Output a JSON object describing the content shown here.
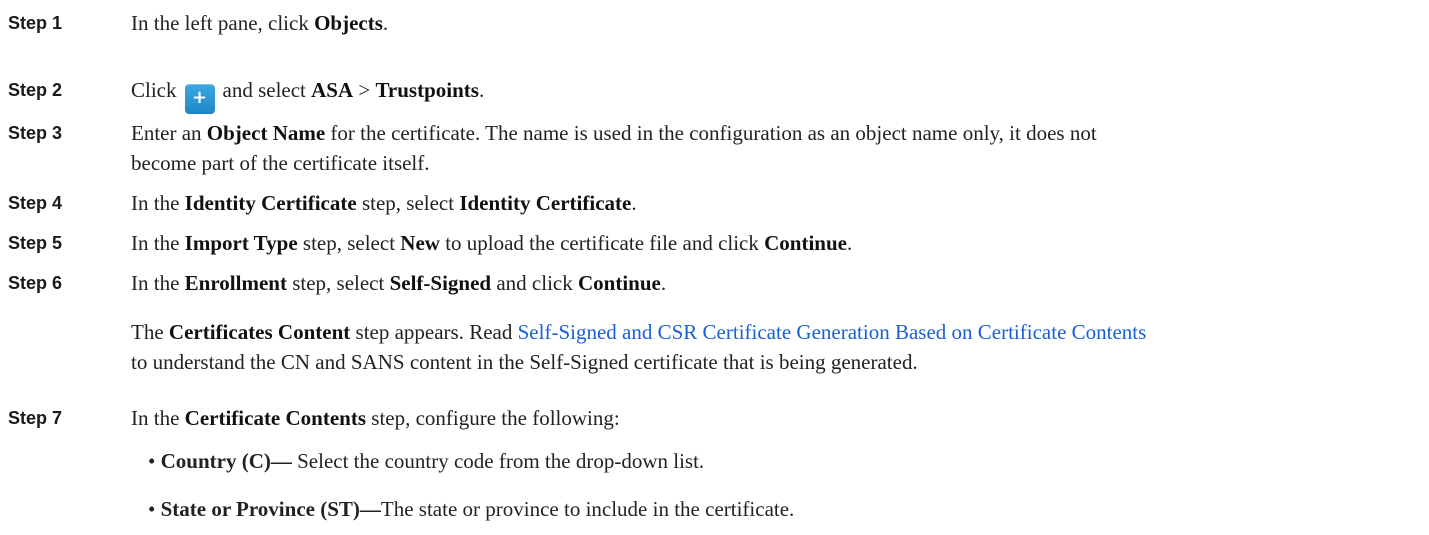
{
  "steps": [
    {
      "label": "Step 1",
      "parts": [
        "In the left pane, click ",
        "Objects",
        "."
      ]
    },
    {
      "label": "Step 2",
      "parts": [
        "Click",
        "and select ",
        "ASA",
        " > ",
        "Trustpoints",
        "."
      ],
      "plus_glyph": "+",
      "plus_icon": "plus-icon"
    },
    {
      "label": "Step 3",
      "parts": [
        "Enter an ",
        "Object Name",
        " for the certificate. The name is used in the configuration as an object name only, it does not",
        "become part of the certificate itself."
      ]
    },
    {
      "label": "Step 4",
      "parts": [
        "In the ",
        "Identity Certificate",
        " step, select ",
        "Identity Certificate",
        "."
      ]
    },
    {
      "label": "Step 5",
      "parts": [
        "In the ",
        "Import Type",
        " step, select ",
        "New",
        " to upload the certificate file and click ",
        "Continue",
        "."
      ]
    },
    {
      "label": "Step 6",
      "parts": [
        "In the ",
        "Enrollment",
        " step, select ",
        "Self-Signed",
        " and click ",
        "Continue",
        "."
      ]
    },
    {
      "label": "Step 7",
      "parts": [
        "In the ",
        "Certificate Contents",
        " step, configure the following:"
      ]
    }
  ],
  "note": {
    "pre": "The ",
    "bold": "Certificates Content",
    "mid": " step appears. Read ",
    "link": "Self-Signed and CSR Certificate Generation Based on Certificate Contents",
    "post": "to understand the CN and SANS content in the Self-Signed certificate that is being generated."
  },
  "bullets": [
    {
      "mark": "•",
      "bold": "Country (C)—",
      "text": " Select the country code from the drop-down list."
    },
    {
      "mark": "•",
      "bold": "State or Province (ST)—",
      "text": "The state or province to include in the certificate."
    }
  ],
  "colors": {
    "link": "#1a5fd6",
    "button": "#2a97d6"
  }
}
